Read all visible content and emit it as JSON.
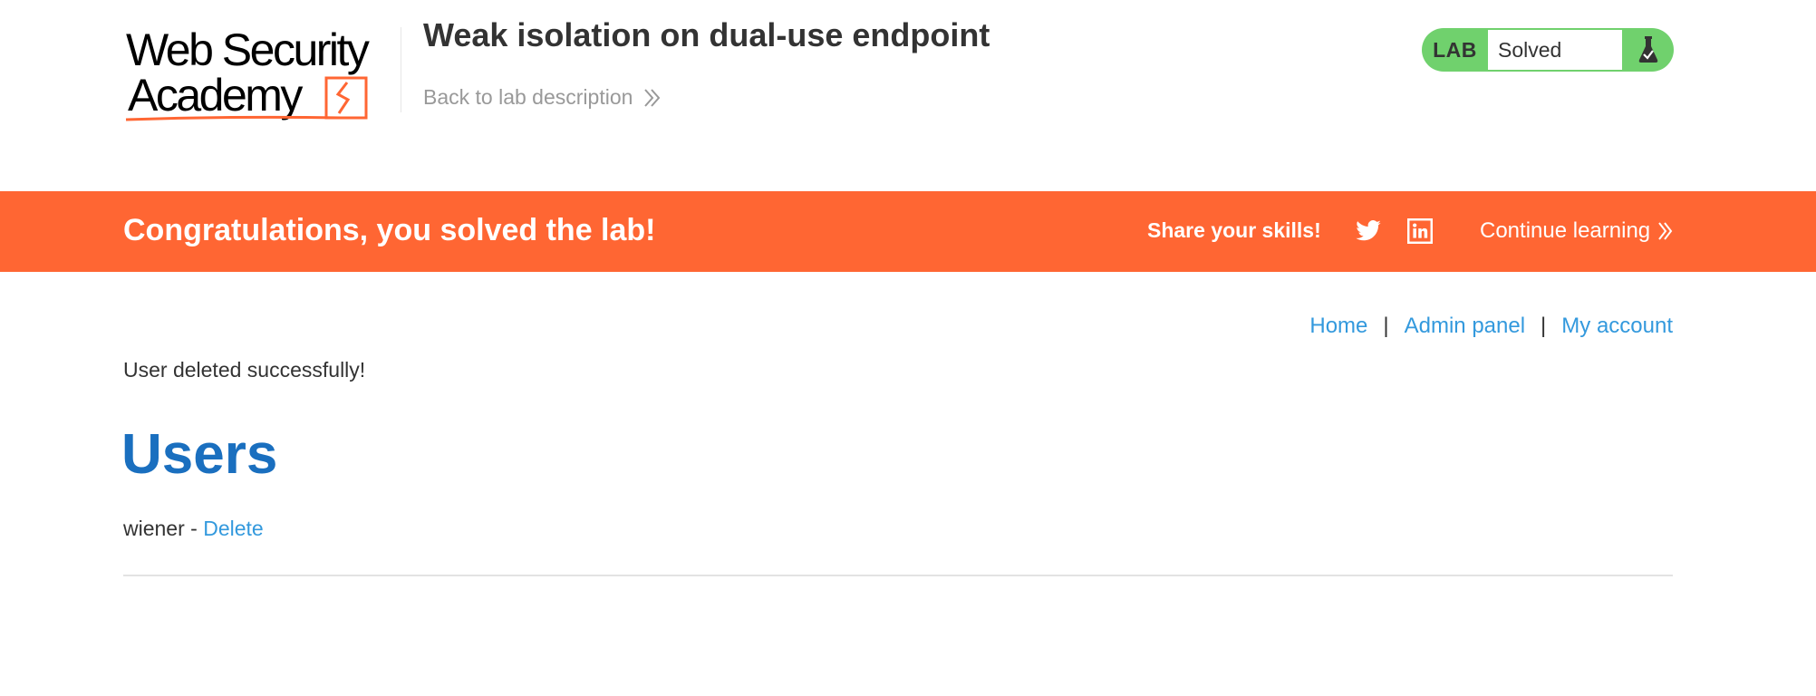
{
  "header": {
    "logo_text": [
      "Web Security",
      "Academy"
    ],
    "lab_title": "Weak isolation on dual-use endpoint",
    "back_link": "Back to lab description"
  },
  "lab_status": {
    "label": "LAB",
    "status": "Solved",
    "icon": "flask-icon"
  },
  "banner": {
    "message": "Congratulations, you solved the lab!",
    "share_label": "Share your skills!",
    "continue_label": "Continue learning",
    "icons": [
      "twitter-icon",
      "linkedin-icon"
    ]
  },
  "nav": {
    "home": "Home",
    "separator": "|",
    "admin_panel": "Admin panel",
    "my_account": "My account"
  },
  "main": {
    "notice": "User deleted successfully!",
    "section_title": "Users",
    "users": [
      {
        "name": "wiener",
        "separator": "-",
        "action": "Delete"
      }
    ]
  },
  "colors": {
    "brand_orange": "#ff6633",
    "status_green": "#70d16d",
    "link_blue": "#3399dd",
    "heading_blue": "#1a6fbf"
  }
}
